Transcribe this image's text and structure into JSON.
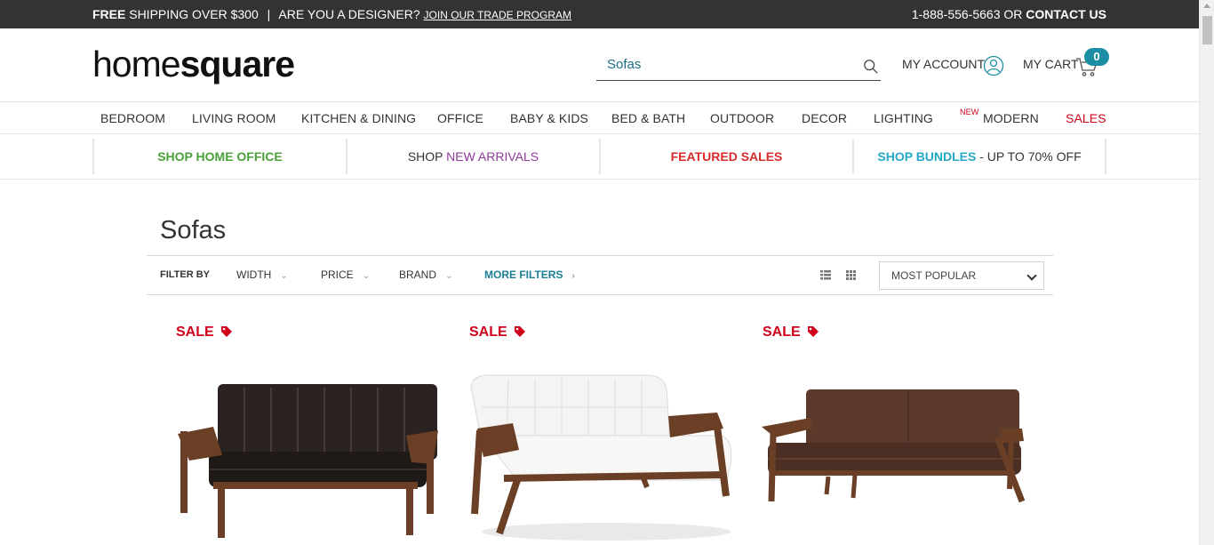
{
  "topbar": {
    "free": "FREE",
    "shipping": "SHIPPING OVER $300",
    "sep": "|",
    "designer": "ARE YOU A DESIGNER?",
    "trade_link": "JOIN OUR TRADE PROGRAM",
    "phone": "1-888-556-5663 OR",
    "contact": "CONTACT US"
  },
  "logo": {
    "part1": "home",
    "part2": "square"
  },
  "search": {
    "value": "Sofas",
    "placeholder": ""
  },
  "account": {
    "label": "MY ACCOUNT"
  },
  "cart": {
    "label": "MY CART",
    "count": "0"
  },
  "nav": {
    "bedroom": "BEDROOM",
    "living": "LIVING ROOM",
    "kitchen": "KITCHEN & DINING",
    "office": "OFFICE",
    "baby": "BABY & KIDS",
    "bed_bath": "BED & BATH",
    "outdoor": "OUTDOOR",
    "decor": "DECOR",
    "lighting": "LIGHTING",
    "new_tag": "NEW",
    "modern": "MODERN",
    "sales": "SALES"
  },
  "promo": {
    "home_office": "SHOP HOME OFFICE",
    "shop": "SHOP",
    "new_arrivals": "NEW ARRIVALS",
    "featured": "FEATURED SALES",
    "bundles": "SHOP BUNDLES",
    "bundles_rest": " - UP TO 70% OFF"
  },
  "page": {
    "title": "Sofas"
  },
  "filters": {
    "label": "FILTER BY",
    "width": "WIDTH",
    "price": "PRICE",
    "brand": "BRAND",
    "more": "MORE FILTERS",
    "sort_value": "MOST POPULAR"
  },
  "products": [
    {
      "badge": "SALE",
      "color": "#2b2321"
    },
    {
      "badge": "SALE",
      "color": "#f4f4f2"
    },
    {
      "badge": "SALE",
      "color": "#5b3a2c"
    }
  ],
  "colors": {
    "topbar": "#333333",
    "accent": "#1b8ea3",
    "sale": "#d0021b",
    "green": "#4aa03a",
    "purple": "#8e3a9a",
    "teal": "#25a9c6",
    "wood": "#6a3f25"
  }
}
